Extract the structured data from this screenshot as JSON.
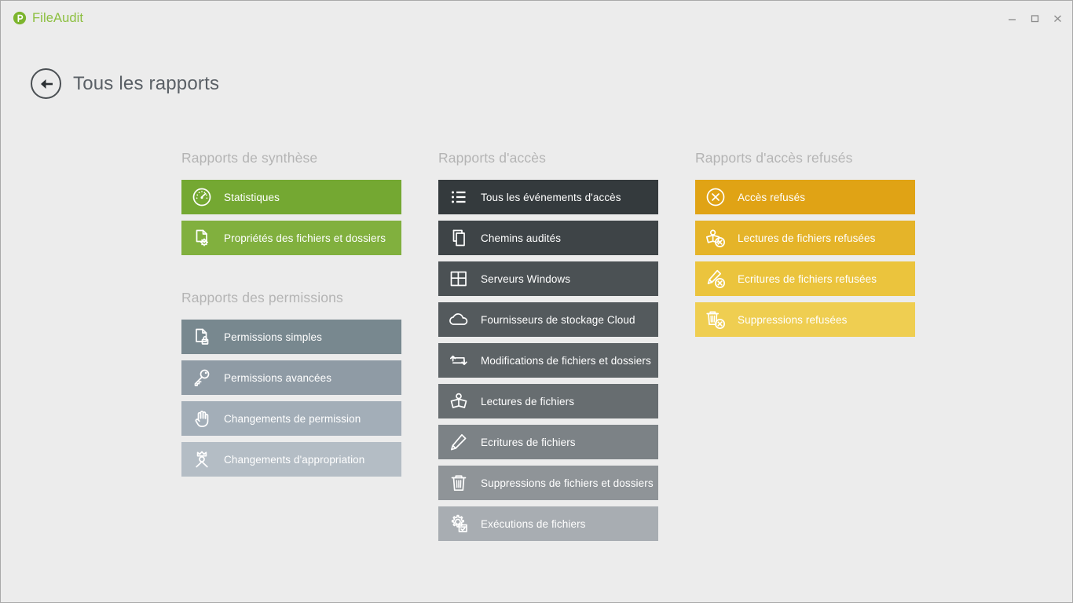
{
  "window": {
    "app_name": "FileAudit",
    "logo_icon": "fileaudit-logo-icon",
    "controls": [
      {
        "name": "minimize-button",
        "icon": "minimize-icon",
        "glyph": "–"
      },
      {
        "name": "maximize-button",
        "icon": "maximize-icon",
        "glyph": "□"
      },
      {
        "name": "close-button",
        "icon": "close-icon",
        "glyph": "✕"
      }
    ]
  },
  "header": {
    "back_icon": "back-arrow-icon",
    "title": "Tous les rapports"
  },
  "colors": {
    "window_bg": "#ececec",
    "brand_green": "#8CBF3F",
    "group_title": "#b4b4b4",
    "page_title": "#5a6066",
    "green_tiles": [
      "#74A832",
      "#81B03E"
    ],
    "slate_tiles": [
      "#78888F",
      "#8F9BA5",
      "#A3AEB8",
      "#B4BDC5"
    ],
    "dark_tiles": [
      "#343A3D",
      "#3E4447",
      "#4B5154",
      "#545A5D",
      "#5D6366",
      "#676D70",
      "#7C8286",
      "#8F9498",
      "#A8ADB2"
    ],
    "gold_tiles": [
      "#E0A315",
      "#E5B429",
      "#EBC43D",
      "#EFCE51"
    ]
  },
  "columns": [
    {
      "name": "column-summary-and-permissions",
      "groups": [
        {
          "name": "group-rapports-de-synthese",
          "title": "Rapports de synthèse",
          "tiles": [
            {
              "label": "Statistiques",
              "icon": "gauge-icon",
              "color": "#74A832"
            },
            {
              "label": "Propriétés des fichiers et dossiers",
              "icon": "file-properties-icon",
              "color": "#81B03E"
            }
          ]
        },
        {
          "name": "group-rapports-des-permissions",
          "title": "Rapports des permissions",
          "tiles": [
            {
              "label": "Permissions simples",
              "icon": "file-lock-icon",
              "color": "#78888F"
            },
            {
              "label": "Permissions avancées",
              "icon": "key-icon",
              "color": "#8F9BA5"
            },
            {
              "label": "Changements de permission",
              "icon": "hand-icon",
              "color": "#A3AEB8"
            },
            {
              "label": "Changements d'appropriation",
              "icon": "crowned-user-icon",
              "color": "#B4BDC5"
            }
          ]
        }
      ]
    },
    {
      "name": "column-access-reports",
      "groups": [
        {
          "name": "group-rapports-dacces",
          "title": "Rapports d'accès",
          "tiles": [
            {
              "label": "Tous les événements d'accès",
              "icon": "list-icon",
              "color": "#343A3D"
            },
            {
              "label": "Chemins audités",
              "icon": "copy-documents-icon",
              "color": "#3E4447"
            },
            {
              "label": "Serveurs Windows",
              "icon": "windows-icon",
              "color": "#4B5154"
            },
            {
              "label": "Fournisseurs de stockage Cloud",
              "icon": "cloud-icon",
              "color": "#545A5D"
            },
            {
              "label": "Modifications de fichiers et dossiers",
              "icon": "exchange-arrows-icon",
              "color": "#5D6366"
            },
            {
              "label": "Lectures de fichiers",
              "icon": "open-book-icon",
              "color": "#676D70"
            },
            {
              "label": "Ecritures de fichiers",
              "icon": "pencil-icon",
              "color": "#7C8286"
            },
            {
              "label": "Suppressions de fichiers et dossiers",
              "icon": "trash-icon",
              "color": "#8F9498"
            },
            {
              "label": "Exécutions de fichiers",
              "icon": "gear-window-icon",
              "color": "#A8ADB2"
            }
          ]
        }
      ]
    },
    {
      "name": "column-denied-access-reports",
      "groups": [
        {
          "name": "group-rapports-dacces-refuses",
          "title": "Rapports d'accès refusés",
          "tiles": [
            {
              "label": "Accès refusés",
              "icon": "circle-x-icon",
              "color": "#E0A315"
            },
            {
              "label": "Lectures de fichiers refusées",
              "icon": "open-book-denied-icon",
              "color": "#E5B429"
            },
            {
              "label": "Ecritures de fichiers refusées",
              "icon": "pencil-denied-icon",
              "color": "#EBC43D"
            },
            {
              "label": "Suppressions refusées",
              "icon": "trash-denied-icon",
              "color": "#EFCE51"
            }
          ]
        }
      ]
    }
  ]
}
